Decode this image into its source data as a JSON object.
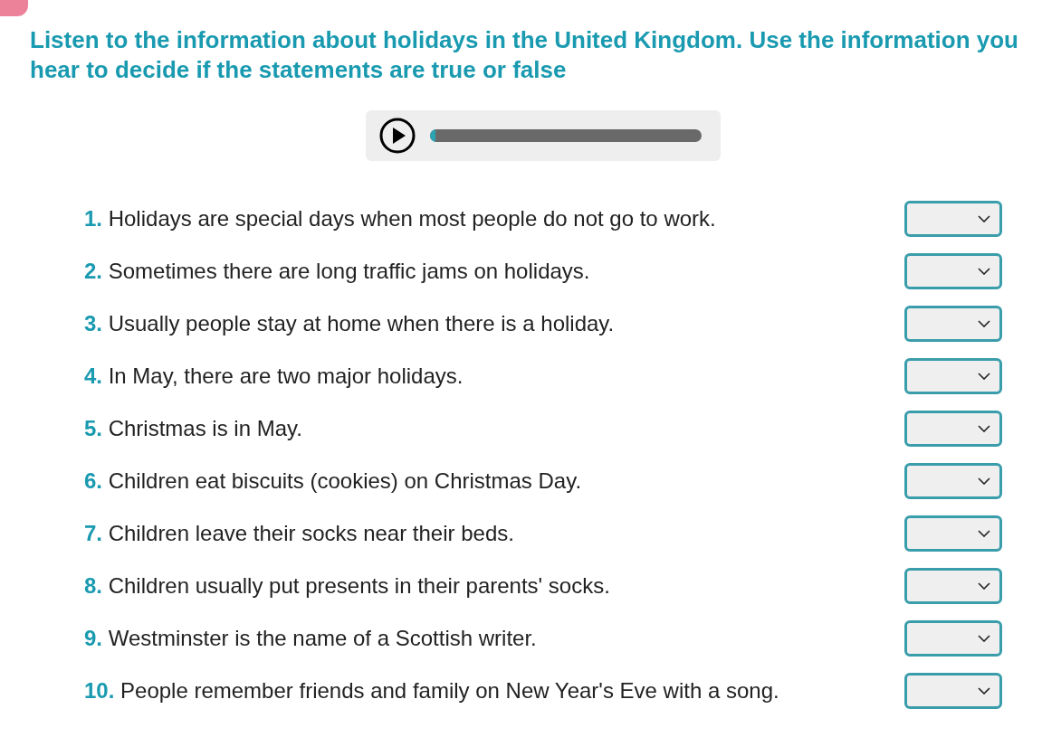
{
  "instruction": "Listen to the information about holidays in the United Kingdom. Use the information you hear to decide if the statements are true or false",
  "audio_player": {
    "level": 0.02
  },
  "statements": [
    {
      "number": "1.",
      "text": "Holidays are special days when most people do not go to work."
    },
    {
      "number": "2.",
      "text": "Sometimes there are long traffic jams on holidays."
    },
    {
      "number": "3.",
      "text": "Usually people stay at home when there is a holiday."
    },
    {
      "number": "4.",
      "text": "In May, there are two major holidays."
    },
    {
      "number": "5.",
      "text": "Christmas is in May."
    },
    {
      "number": "6.",
      "text": "Children eat biscuits (cookies) on Christmas Day."
    },
    {
      "number": "7.",
      "text": "Children leave their socks near their beds."
    },
    {
      "number": "8.",
      "text": "Children usually put presents in their parents' socks."
    },
    {
      "number": "9.",
      "text": "Westminster is the name of a Scottish writer."
    },
    {
      "number": "10.",
      "text": "People remember friends and family on New Year's Eve with a song."
    }
  ]
}
